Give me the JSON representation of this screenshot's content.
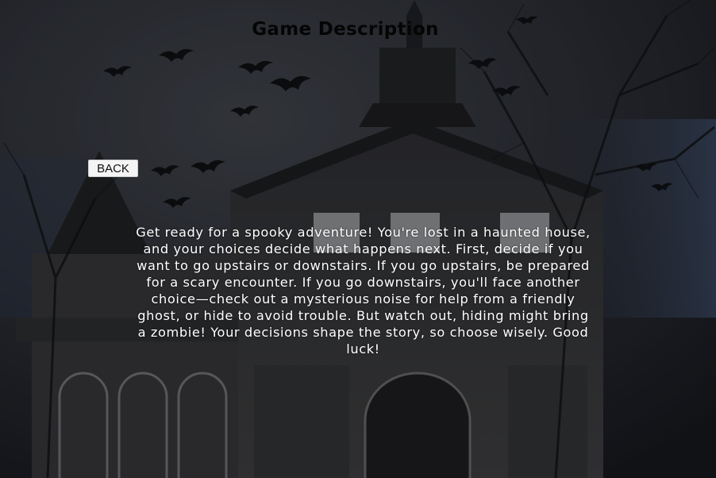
{
  "screen": {
    "title": "Game Description",
    "back_label": "BACK",
    "description": "Get ready for a spooky adventure! You're lost in a haunted house, and your choices decide what happens next. First, decide if you want to go upstairs or downstairs. If you go upstairs, be prepared for a scary encounter. If you go downstairs, you'll face another choice—check out a mysterious noise for help from a friendly ghost, or hide to avoid trouble. But watch out, hiding might bring a zombie! Your decisions shape the story, so choose wisely. Good luck!"
  },
  "colors": {
    "title": "#050505",
    "text": "#ffffff",
    "button_bg": "#f4f4f4"
  },
  "icons": [
    "bat-icon",
    "haunted-house-image"
  ]
}
